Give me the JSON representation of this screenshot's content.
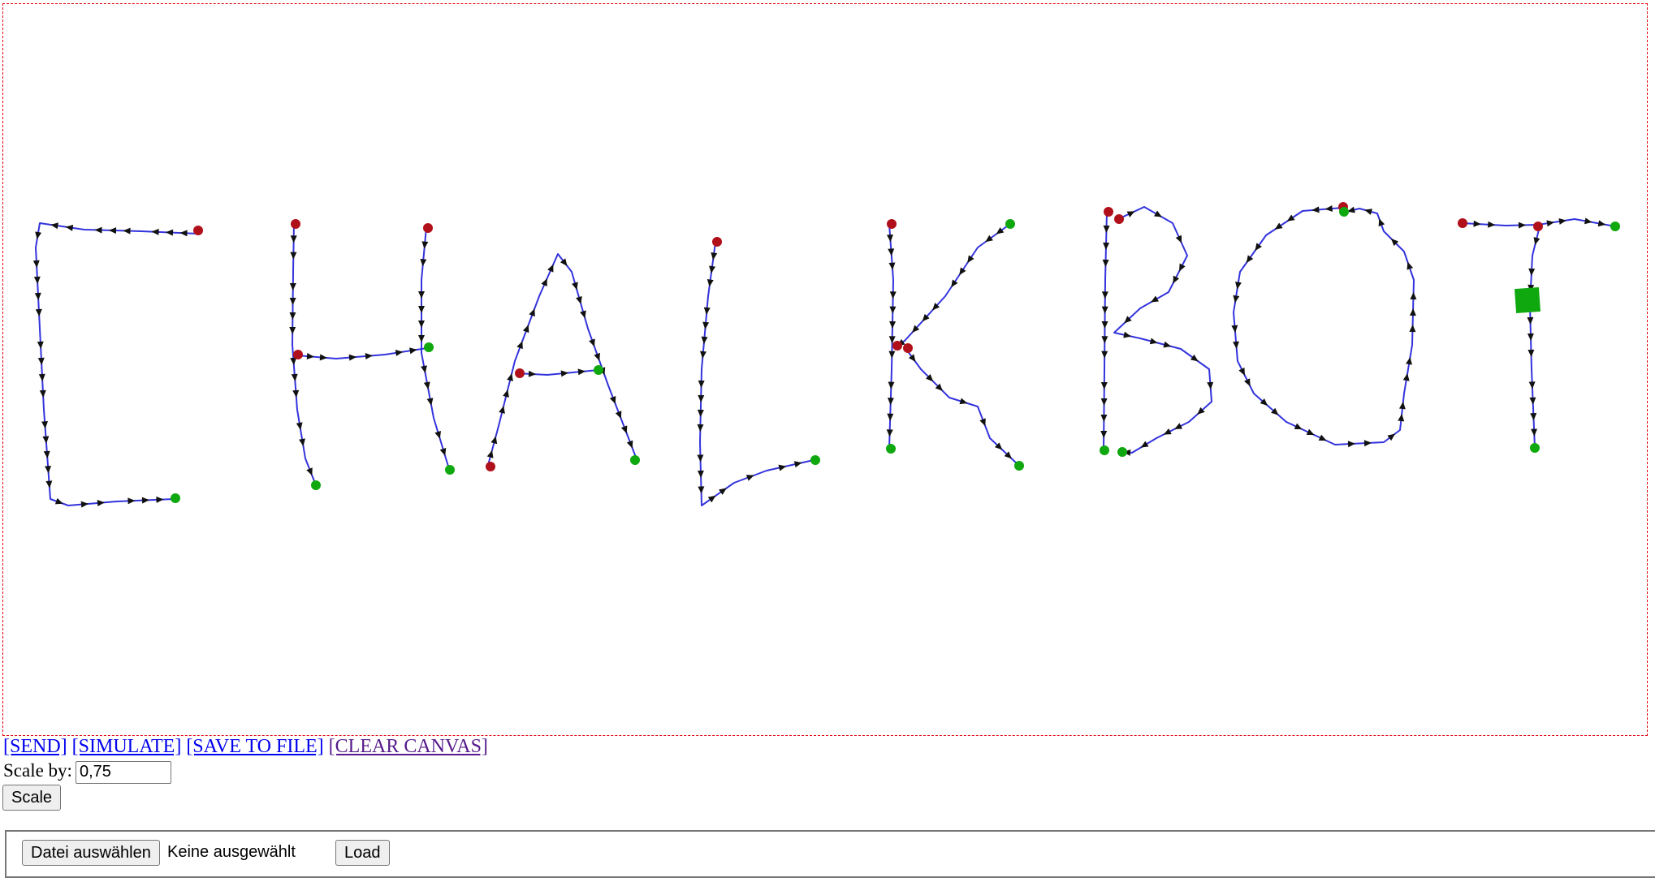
{
  "canvas": {
    "border_color": "#e0000a",
    "stroke_color": "#3333dd",
    "arrow_color": "#111111",
    "start_dot_color": "#b0101a",
    "end_dot_color": "#0fa80f",
    "cursor_marker_color": "#0fa80f"
  },
  "toolbar": {
    "send_label": "[SEND]",
    "simulate_label": "[SIMULATE]",
    "save_label": "[SAVE TO FILE]",
    "clear_label": "[CLEAR CANVAS]"
  },
  "scale": {
    "label": "Scale by:",
    "value": "0,75",
    "button_label": "Scale"
  },
  "file": {
    "choose_label": "Datei auswählen",
    "status": "Keine ausgewählt",
    "load_label": "Load"
  }
}
